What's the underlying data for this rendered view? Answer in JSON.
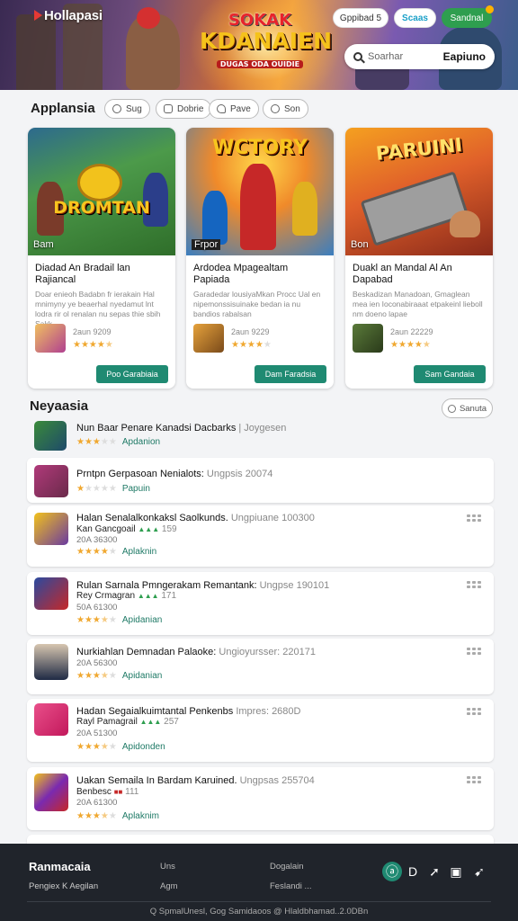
{
  "header": {
    "brand": "Hollapasi",
    "logo": {
      "line1": "SOKAK",
      "line2": "KDANAIEN",
      "line3": "DUGAS ODA OUIDIE"
    },
    "pills": [
      {
        "label": "Gppibad 5"
      },
      {
        "label": "Scaas"
      },
      {
        "label": "Sandnal"
      }
    ],
    "search": {
      "placeholder": "Soarhar",
      "button": "Eapiuno"
    }
  },
  "featured": {
    "title": "Applansia",
    "chips": [
      {
        "label": "Sug",
        "icon": "chat-icon"
      },
      {
        "label": "Dobrie",
        "icon": "calendar-icon"
      },
      {
        "label": "Pave",
        "icon": "heart-icon"
      },
      {
        "label": "Son",
        "icon": "globe-icon"
      }
    ],
    "cards": [
      {
        "art_title": "DROMTAN",
        "badge": "Bam",
        "title": "Diadad An Bradail lan Rajiancal",
        "desc": "Doar enieoh Badabn fr ierakain Hal mnimyny ye beaerhal nyedamut lnt lodra rir ol renalan nu sepas thie sbih Sakk",
        "meta": "2aun 9209",
        "rating": 4.5,
        "cta": "Poo Garabiaia"
      },
      {
        "art_title": "WCTORY",
        "badge": "Frpor",
        "title": "Ardodea Mpagealtam Papiada",
        "desc": "Garadedar lousiyaMkan Procc Ual en nipemonssisuinake bedan ia nu bandios rabalsan",
        "meta": "2aun 9229",
        "rating": 4,
        "cta": "Dam Faradsia"
      },
      {
        "art_title": "PARUINI",
        "badge": "Bon",
        "title": "Duakl an Mandal Al An Dapabad",
        "desc": "Beskadizan Manadoan, Gmaglean mea ien Ioconabiraaat etpakeinl lieboll nm doeno lapae",
        "meta": "2aun 22229",
        "rating": 4.5,
        "cta": "Sam Gandaia"
      }
    ]
  },
  "list": {
    "title": "Neyaasia",
    "button": "Sanuta",
    "items": [
      {
        "title": "Nun Baar Penare Kanadsi Dacbarks",
        "extra": " | Joygesen",
        "sub": "",
        "sub_extra": "",
        "size": "",
        "rating": 2,
        "action": "Apdanion",
        "icon": "game-thumb-forest"
      },
      {
        "title": "Prntpn Gerpasoan Nenialots:",
        "extra": " Ungpsis 20074",
        "sub": "",
        "sub_extra": "",
        "size": "",
        "rating": 0.5,
        "action": "Papuin",
        "icon": "game-thumb-hero"
      },
      {
        "title": "Halan Senalalkonkaksl Saolkunds.",
        "extra": " Ungpiuane 100300",
        "sub": "Kan Gancgoail",
        "sub_extra": " 159",
        "size": "20A 36300",
        "rating": 4,
        "action": "Aplaknin",
        "icon": "game-thumb-action"
      },
      {
        "title": "Rulan Sarnala Pmngerakam Remantank:",
        "extra": " Ungpse 190101",
        "sub": "Rey Crmagran",
        "sub_extra": " 171",
        "size": "50A 61300",
        "rating": 3.5,
        "action": "Apidanian",
        "icon": "game-thumb-red"
      },
      {
        "title": "Nurkiahlan Demnadan Palaoke:",
        "extra": " Ungioyursser: 220171",
        "sub": "",
        "sub_extra": "",
        "size": "20A 56300",
        "rating": 3.5,
        "action": "Apidanian",
        "icon": "game-thumb-person"
      },
      {
        "title": "Hadan Segaialkuimtantal Penkenbs",
        "extra": " Impres: 2680D",
        "sub": "Rayl Pamagrail",
        "sub_extra": " 257",
        "size": "20A 51300",
        "rating": 3.5,
        "action": "Apidonden",
        "icon": "game-thumb-pink"
      },
      {
        "title": "Uakan Semaila In Bardam Karuined.",
        "extra": " Ungpsas 255704",
        "sub": "Benbesc",
        "sub_extra": " 111",
        "size": "20A 61300",
        "rating": 3.5,
        "action": "Aplaknim",
        "icon": "game-thumb-colorful"
      }
    ]
  },
  "footer": {
    "name": "Ranmacaia",
    "sub": "Pengiex  K Aegilan",
    "col1": [
      "Uns",
      "Agm"
    ],
    "col2": [
      "Dogalain",
      "Feslandi ..."
    ],
    "copyright": "Q  SpmalUnesl,   Gog Samidaoos @ Hlaldbhamad..2.0DBn"
  },
  "colors": {
    "accent": "#1f8a72",
    "star": "#f0a830",
    "footer": "#20242b"
  }
}
